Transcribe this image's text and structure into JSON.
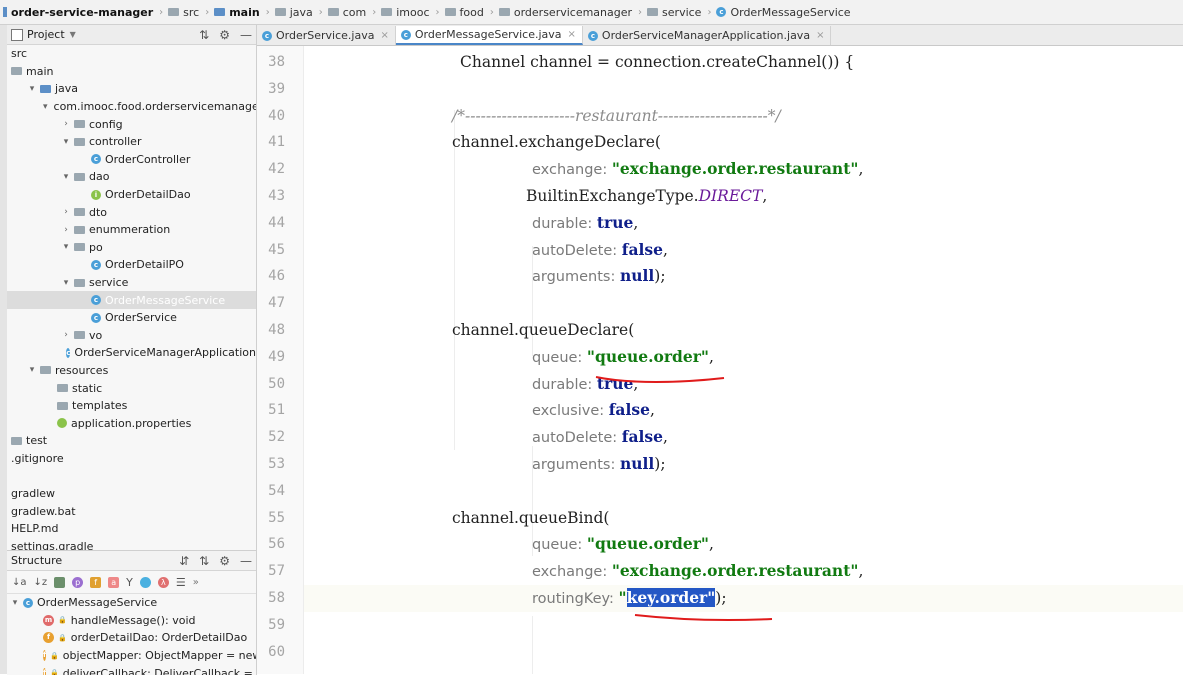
{
  "breadcrumb": [
    {
      "label": "order-service-manager",
      "icon": "project-icon",
      "bold": true
    },
    {
      "label": "src",
      "icon": "folder-icon"
    },
    {
      "label": "main",
      "icon": "folder-icon",
      "bold": true
    },
    {
      "label": "java",
      "icon": "folder-icon"
    },
    {
      "label": "com",
      "icon": "folder-icon"
    },
    {
      "label": "imooc",
      "icon": "folder-icon"
    },
    {
      "label": "food",
      "icon": "folder-icon"
    },
    {
      "label": "orderservicemanager",
      "icon": "folder-icon"
    },
    {
      "label": "service",
      "icon": "folder-icon"
    },
    {
      "label": "OrderMessageService",
      "icon": "class-icon"
    }
  ],
  "project_panel": {
    "title": "Project",
    "tree": [
      {
        "label": "src",
        "indent": 0,
        "arrow": "",
        "icon": "none"
      },
      {
        "label": "main",
        "indent": 0,
        "arrow": "",
        "icon": "folder"
      },
      {
        "label": "java",
        "indent": 1,
        "arrow": "down",
        "icon": "folder-blue"
      },
      {
        "label": "com.imooc.food.orderservicemanager",
        "indent": 2,
        "arrow": "down",
        "icon": "folder"
      },
      {
        "label": "config",
        "indent": 3,
        "arrow": "right",
        "icon": "folder"
      },
      {
        "label": "controller",
        "indent": 3,
        "arrow": "down",
        "icon": "folder"
      },
      {
        "label": "OrderController",
        "indent": 4,
        "arrow": "",
        "icon": "class"
      },
      {
        "label": "dao",
        "indent": 3,
        "arrow": "down",
        "icon": "folder"
      },
      {
        "label": "OrderDetailDao",
        "indent": 4,
        "arrow": "",
        "icon": "interface"
      },
      {
        "label": "dto",
        "indent": 3,
        "arrow": "right",
        "icon": "folder"
      },
      {
        "label": "enummeration",
        "indent": 3,
        "arrow": "right",
        "icon": "folder"
      },
      {
        "label": "po",
        "indent": 3,
        "arrow": "down",
        "icon": "folder"
      },
      {
        "label": "OrderDetailPO",
        "indent": 4,
        "arrow": "",
        "icon": "class"
      },
      {
        "label": "service",
        "indent": 3,
        "arrow": "down",
        "icon": "folder"
      },
      {
        "label": "OrderMessageService",
        "indent": 4,
        "arrow": "",
        "icon": "class",
        "selected": true
      },
      {
        "label": "OrderService",
        "indent": 4,
        "arrow": "",
        "icon": "class"
      },
      {
        "label": "vo",
        "indent": 3,
        "arrow": "right",
        "icon": "folder"
      },
      {
        "label": "OrderServiceManagerApplication",
        "indent": 3,
        "arrow": "",
        "icon": "class"
      },
      {
        "label": "resources",
        "indent": 1,
        "arrow": "down",
        "icon": "folder"
      },
      {
        "label": "static",
        "indent": 2,
        "arrow": "",
        "icon": "folder"
      },
      {
        "label": "templates",
        "indent": 2,
        "arrow": "",
        "icon": "folder"
      },
      {
        "label": "application.properties",
        "indent": 2,
        "arrow": "",
        "icon": "props"
      },
      {
        "label": "test",
        "indent": 0,
        "arrow": "",
        "icon": "folder"
      },
      {
        "label": ".gitignore",
        "indent": 0,
        "arrow": "",
        "icon": "none"
      },
      {
        "label": "",
        "indent": 0,
        "arrow": "",
        "icon": "none"
      },
      {
        "label": "gradlew",
        "indent": 0,
        "arrow": "",
        "icon": "none"
      },
      {
        "label": "gradlew.bat",
        "indent": 0,
        "arrow": "",
        "icon": "none"
      },
      {
        "label": "HELP.md",
        "indent": 0,
        "arrow": "",
        "icon": "none"
      },
      {
        "label": "settings.gradle",
        "indent": 0,
        "arrow": "",
        "icon": "none"
      }
    ]
  },
  "structure_panel": {
    "title": "Structure",
    "root": "OrderMessageService",
    "members": [
      {
        "badge": "m",
        "label": "handleMessage(): void"
      },
      {
        "badge": "f",
        "label": "orderDetailDao: OrderDetailDao"
      },
      {
        "badge": "f",
        "label": "objectMapper: ObjectMapper = new"
      },
      {
        "badge": "f",
        "label": "deliverCallback: DeliverCallback = (co"
      }
    ]
  },
  "tabs": [
    {
      "label": "OrderService.java",
      "active": false
    },
    {
      "label": "OrderMessageService.java",
      "active": true
    },
    {
      "label": "OrderServiceManagerApplication.java",
      "active": false
    }
  ],
  "code": {
    "line_numbers": [
      "38",
      "39",
      "40",
      "41",
      "42",
      "43",
      "44",
      "45",
      "46",
      "47",
      "48",
      "49",
      "50",
      "51",
      "52",
      "53",
      "54",
      "55",
      "56",
      "57",
      "58",
      "59",
      "60"
    ],
    "lines": [
      [
        {
          "t": "Channel channel = connection.createChannel()) {",
          "c": ""
        }
      ],
      [],
      [
        {
          "t": "/*---------------------restaurant---------------------*/",
          "c": "comment"
        }
      ],
      [
        {
          "t": "channel.exchangeDeclare(",
          "c": ""
        }
      ],
      [
        {
          "t": "exchange: ",
          "c": "param"
        },
        {
          "t": "\"exchange.order.restaurant\"",
          "c": "str"
        },
        {
          "t": ",",
          "c": ""
        }
      ],
      [
        {
          "t": "BuiltinExchangeType.",
          "c": ""
        },
        {
          "t": "DIRECT",
          "c": "const"
        },
        {
          "t": ",",
          "c": ""
        }
      ],
      [
        {
          "t": "durable: ",
          "c": "param"
        },
        {
          "t": "true",
          "c": "kw"
        },
        {
          "t": ",",
          "c": ""
        }
      ],
      [
        {
          "t": "autoDelete: ",
          "c": "param"
        },
        {
          "t": "false",
          "c": "kw"
        },
        {
          "t": ",",
          "c": ""
        }
      ],
      [
        {
          "t": "arguments: ",
          "c": "param"
        },
        {
          "t": "null",
          "c": "kw"
        },
        {
          "t": ");",
          "c": ""
        }
      ],
      [],
      [
        {
          "t": "channel.queueDeclare(",
          "c": ""
        }
      ],
      [
        {
          "t": "queue: ",
          "c": "param"
        },
        {
          "t": "\"queue.order\"",
          "c": "str"
        },
        {
          "t": ",",
          "c": ""
        }
      ],
      [
        {
          "t": "durable: ",
          "c": "param"
        },
        {
          "t": "true",
          "c": "kw"
        },
        {
          "t": ",",
          "c": ""
        }
      ],
      [
        {
          "t": "exclusive: ",
          "c": "param"
        },
        {
          "t": "false",
          "c": "kw"
        },
        {
          "t": ",",
          "c": ""
        }
      ],
      [
        {
          "t": "autoDelete: ",
          "c": "param"
        },
        {
          "t": "false",
          "c": "kw"
        },
        {
          "t": ",",
          "c": ""
        }
      ],
      [
        {
          "t": "arguments: ",
          "c": "param"
        },
        {
          "t": "null",
          "c": "kw"
        },
        {
          "t": ");",
          "c": ""
        }
      ],
      [],
      [
        {
          "t": "channel.queueBind(",
          "c": ""
        }
      ],
      [
        {
          "t": "queue: ",
          "c": "param"
        },
        {
          "t": "\"queue.order\"",
          "c": "str"
        },
        {
          "t": ",",
          "c": ""
        }
      ],
      [
        {
          "t": "exchange: ",
          "c": "param"
        },
        {
          "t": "\"exchange.order.restaurant\"",
          "c": "str"
        },
        {
          "t": ",",
          "c": ""
        }
      ],
      [
        {
          "t": "routingKey: ",
          "c": "param"
        },
        {
          "t": "\"",
          "c": "str"
        },
        {
          "t": "key.order\"",
          "c": "sel"
        },
        {
          "t": ");",
          "c": ""
        }
      ],
      [],
      []
    ],
    "current_line": "58"
  },
  "colors": {
    "annotation": "#e01b1b",
    "selection": "#2457c5",
    "string": "#117a11",
    "keyword": "#0f1f8a"
  }
}
